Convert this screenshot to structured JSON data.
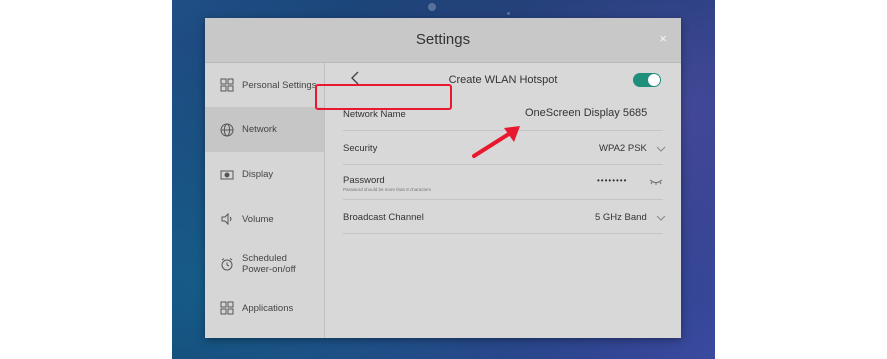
{
  "dialog": {
    "title": "Settings",
    "close": "×"
  },
  "sidebar": {
    "items": [
      {
        "label": "Personal Settings",
        "icon": "grid-icon"
      },
      {
        "label": "Network",
        "icon": "globe-icon",
        "active": true
      },
      {
        "label": "Display",
        "icon": "display-icon"
      },
      {
        "label": "Volume",
        "icon": "speaker-icon"
      },
      {
        "label": "Scheduled Power-on/off",
        "icon": "clock-icon"
      },
      {
        "label": "Applications",
        "icon": "grid-icon"
      }
    ]
  },
  "hotspot": {
    "header": "Create WLAN Hotspot",
    "enabled": true,
    "accent": "#1f8e7a",
    "rows": {
      "network_name": {
        "label": "Network Name",
        "value": "OneScreen Display 5685"
      },
      "security": {
        "label": "Security",
        "value": "WPA2 PSK"
      },
      "password": {
        "label": "Password",
        "hint": "Password should be more than 8 characters",
        "value": "••••••••"
      },
      "broadcast": {
        "label": "Broadcast Channel",
        "value": "5 GHz Band"
      }
    }
  },
  "annotation": {
    "color": "#e8182e"
  }
}
